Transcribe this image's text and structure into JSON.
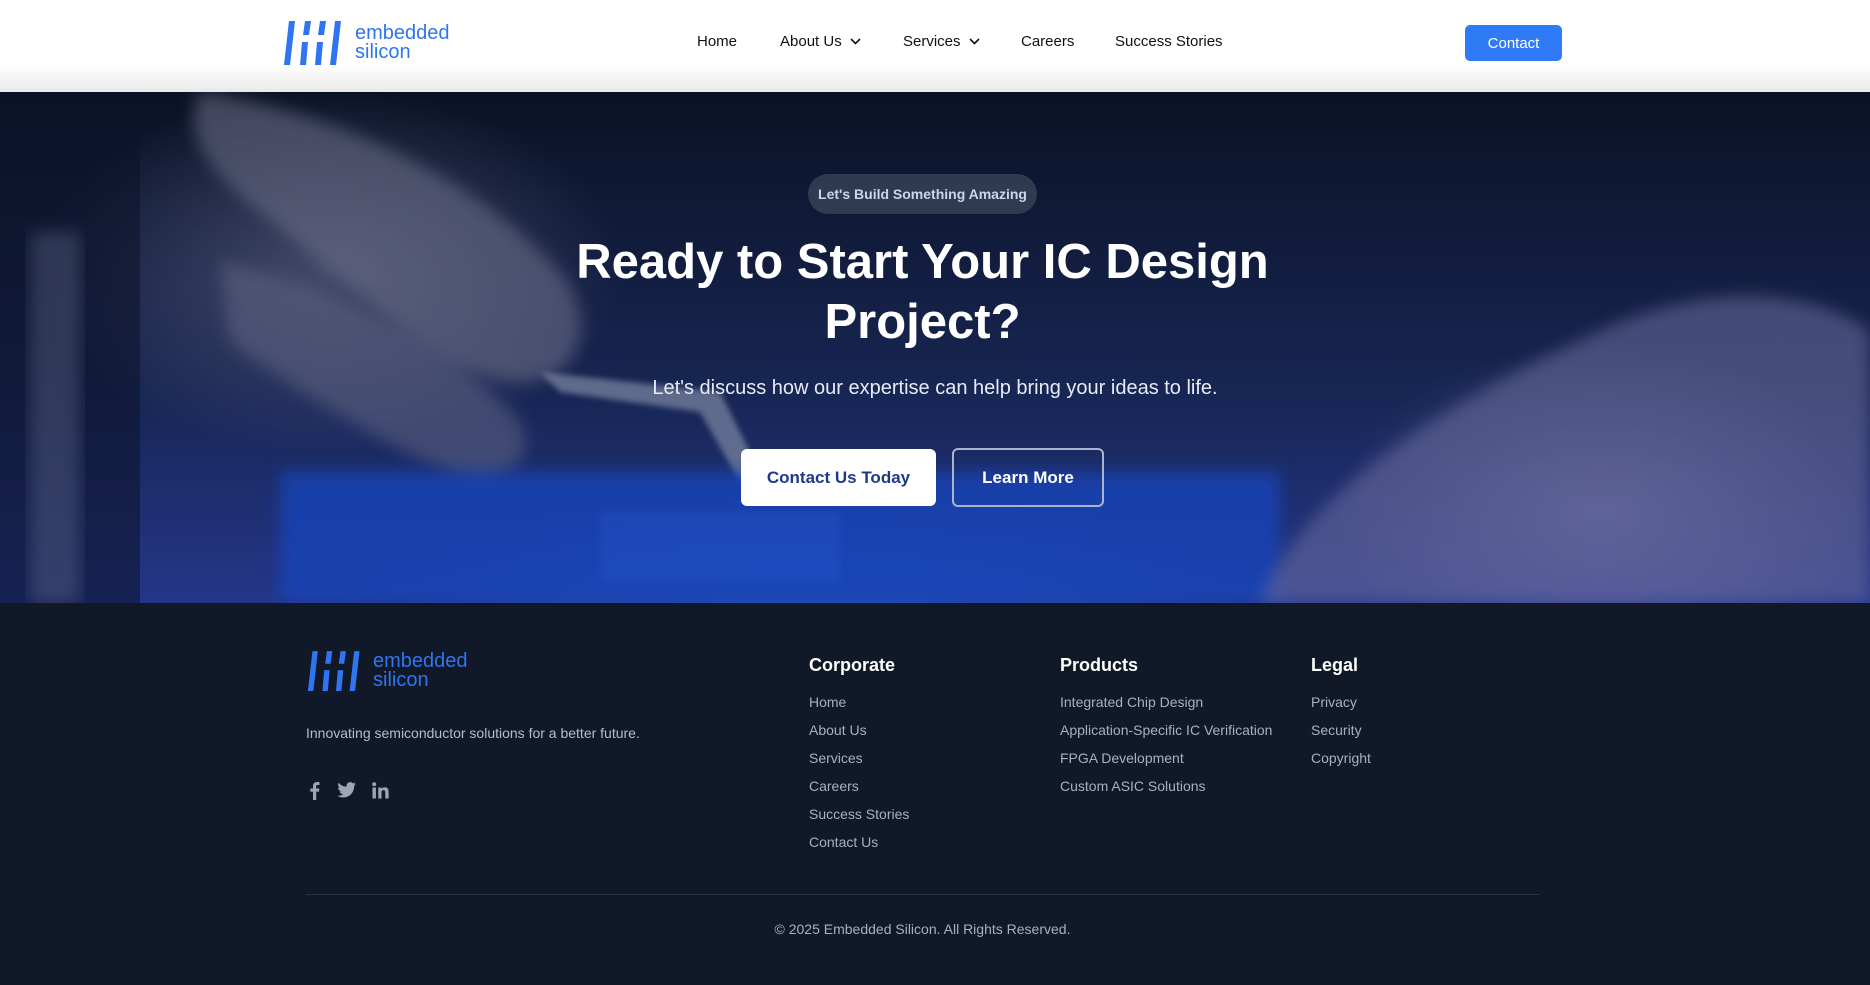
{
  "brand": {
    "line1": "embedded",
    "line2": "silicon",
    "color": "#2f74f0"
  },
  "header": {
    "nav": [
      {
        "label": "Home",
        "has_dropdown": false
      },
      {
        "label": "About Us",
        "has_dropdown": true
      },
      {
        "label": "Services",
        "has_dropdown": true
      },
      {
        "label": "Careers",
        "has_dropdown": false
      },
      {
        "label": "Success Stories",
        "has_dropdown": false
      }
    ],
    "contact_label": "Contact"
  },
  "hero": {
    "badge": "Let's Build Something Amazing",
    "title_line1": "Ready to Start Your IC Design",
    "title_line2": "Project?",
    "subtitle": "Let's discuss how our expertise can help bring your ideas to life.",
    "primary_button": "Contact Us Today",
    "secondary_button": "Learn More"
  },
  "footer": {
    "tagline": "Innovating semiconductor solutions for a better future.",
    "social": [
      "facebook-icon",
      "twitter-icon",
      "linkedin-icon"
    ],
    "columns": [
      {
        "title": "Corporate",
        "links": [
          "Home",
          "About Us",
          "Services",
          "Careers",
          "Success Stories",
          "Contact Us"
        ]
      },
      {
        "title": "Products",
        "links": [
          "Integrated Chip Design",
          "Application-Specific IC Verification",
          "FPGA Development",
          "Custom ASIC Solutions"
        ]
      },
      {
        "title": "Legal",
        "links": [
          "Privacy",
          "Security",
          "Copyright"
        ]
      }
    ],
    "copyright": "© 2025 Embedded Silicon. All Rights Reserved."
  },
  "colors": {
    "accent": "#2f7bf5",
    "footer_bg": "#111827"
  }
}
